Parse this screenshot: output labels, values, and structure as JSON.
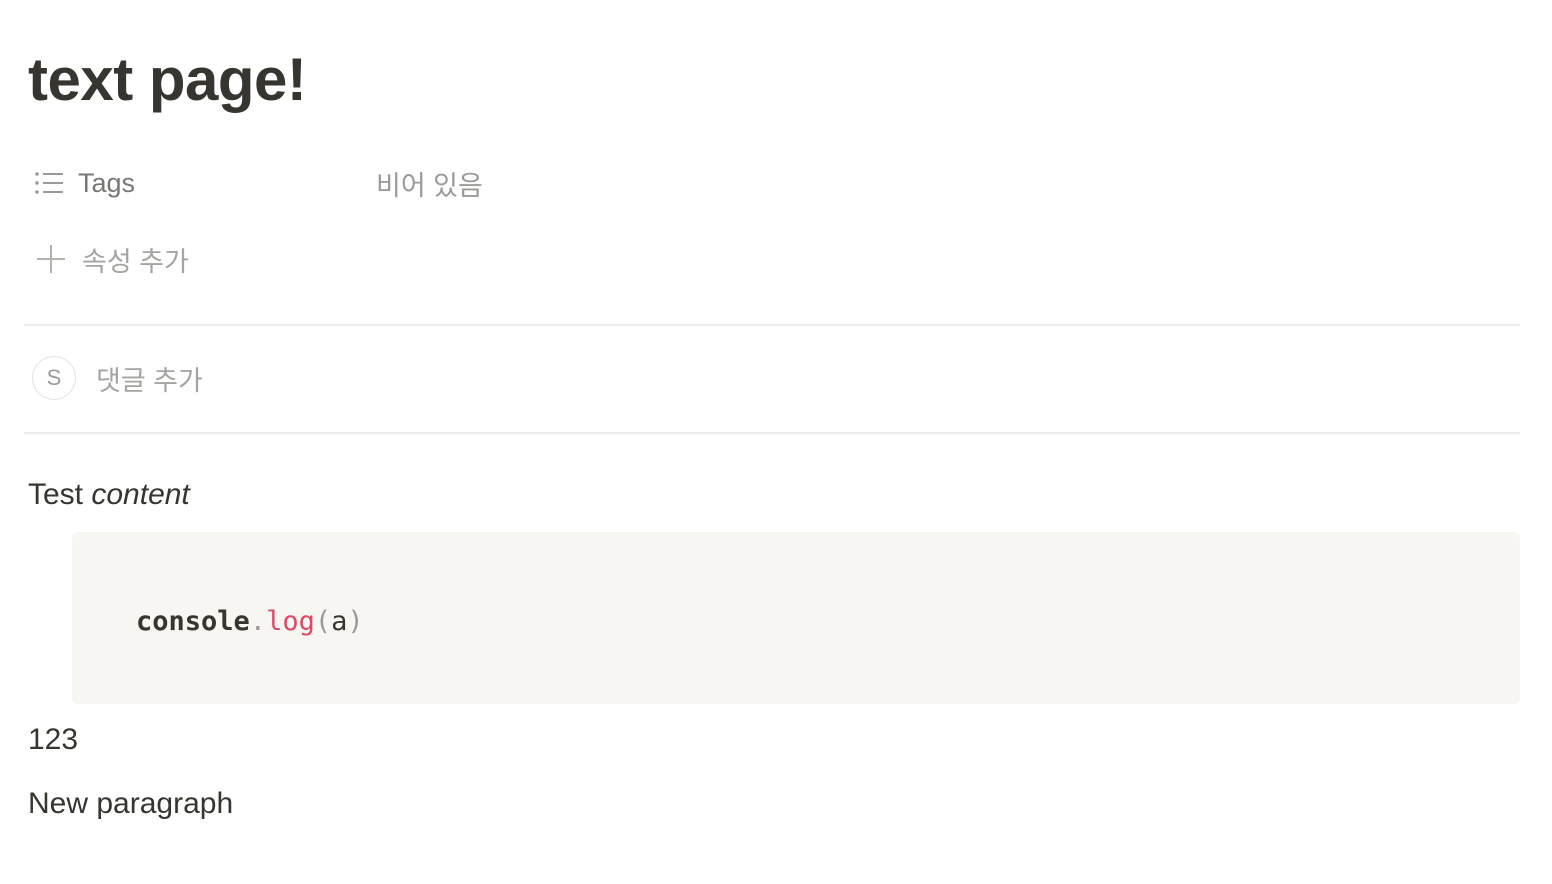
{
  "page": {
    "title": "text page!"
  },
  "properties": [
    {
      "icon": "list-icon",
      "name": "Tags",
      "value": "비어 있음"
    }
  ],
  "add_property": {
    "icon": "plus-icon",
    "label": "속성 추가"
  },
  "comments": {
    "avatar_initial": "S",
    "placeholder": "댓글 추가"
  },
  "content": {
    "paragraph1": {
      "plain": "Test ",
      "italic": "content"
    },
    "code": {
      "object": "console",
      "dot": ".",
      "method": "log",
      "open_paren": "(",
      "argument": "a",
      "close_paren": ")"
    },
    "paragraph2": "123",
    "paragraph3": "New paragraph"
  },
  "colors": {
    "text": "#37352f",
    "muted": "#787774",
    "placeholder": "#a5a4a1",
    "divider": "#ebebea",
    "code_bg": "#f7f6f3",
    "code_function": "#dd4a68"
  }
}
